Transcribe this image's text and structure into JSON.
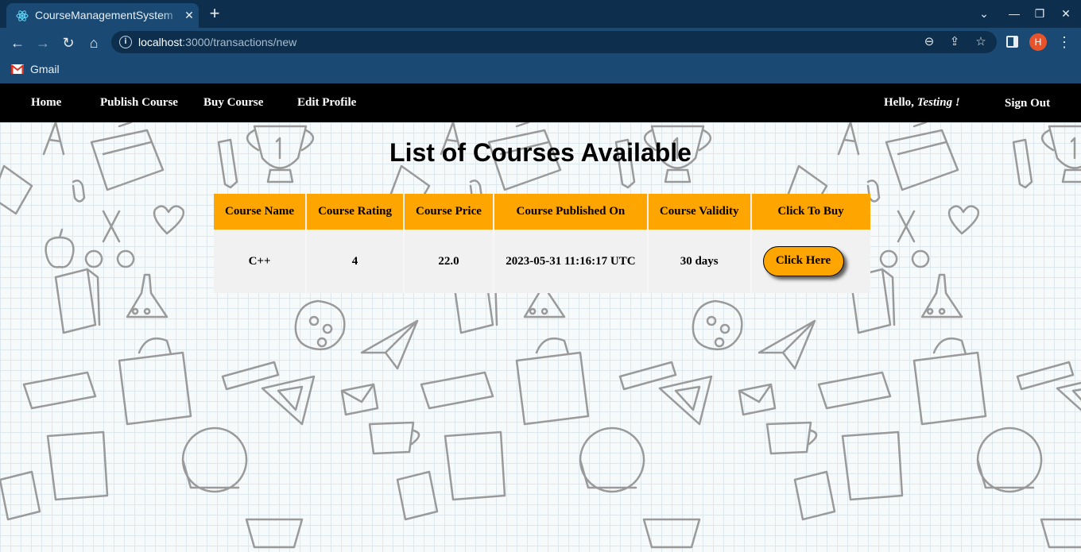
{
  "browser": {
    "tab_title": "CourseManagementSystem",
    "tab_close": "✕",
    "new_tab": "+",
    "win_minimize": "—",
    "win_restore": "❐",
    "win_close": "✕",
    "tab_list": "⌄",
    "nav_back": "←",
    "nav_forward": "→",
    "nav_reload": "↻",
    "nav_home": "⌂",
    "url_host": "localhost",
    "url_path": ":3000/transactions/new",
    "zoom_icon": "⊖",
    "share_icon": "⇪",
    "bookmark_icon": "☆",
    "profile_initial": "H",
    "menu_icon": "⋮",
    "bookmarks": [
      {
        "label": "Gmail"
      }
    ]
  },
  "navbar": {
    "links": [
      "Home",
      "Publish Course",
      "Buy Course",
      "Edit Profile"
    ],
    "greeting_prefix": "Hello, ",
    "greeting_name": "Testing !",
    "sign_out": "Sign Out"
  },
  "page": {
    "title": "List of Courses Available"
  },
  "table": {
    "headers": [
      "Course Name",
      "Course Rating",
      "Course Price",
      "Course Published On",
      "Course Validity",
      "Click To Buy"
    ],
    "rows": [
      {
        "name": "C++",
        "rating": "4",
        "price": "22.0",
        "published_on": "2023-05-31 11:16:17 UTC",
        "validity": "30 days",
        "action": "Click Here"
      }
    ]
  },
  "colors": {
    "navbar_bg": "#000000",
    "accent": "#ffa500",
    "browser_frame": "#1a4a73"
  }
}
